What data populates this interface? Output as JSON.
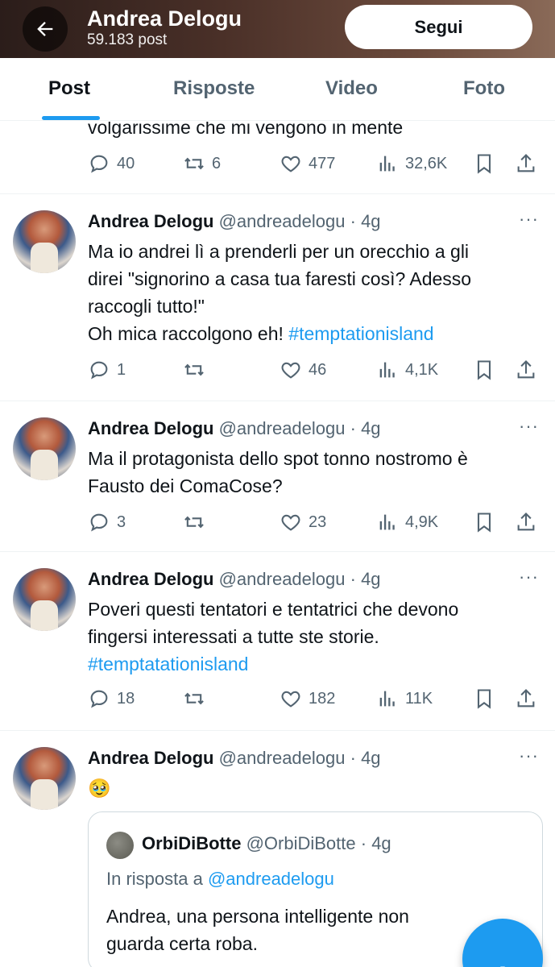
{
  "header": {
    "name": "Andrea Delogu",
    "post_count": "59.183 post",
    "follow_label": "Segui"
  },
  "tabs": [
    {
      "label": "Post",
      "active": true
    },
    {
      "label": "Risposte",
      "active": false
    },
    {
      "label": "Video",
      "active": false
    },
    {
      "label": "Foto",
      "active": false
    }
  ],
  "partial_tweet": {
    "text": "volgarissime che mi vengono in mente",
    "replies": "40",
    "retweets": "6",
    "likes": "477",
    "views": "32,6K"
  },
  "tweets": [
    {
      "name": "Andrea Delogu",
      "handle": "@andreadelogu",
      "time": "· 4g",
      "text": "Ma io andrei lì a prenderli per un orecchio a gli\ndirei \"signorino a casa tua faresti così? Adesso\nraccogli tutto!\"\nOh mica raccolgono eh! ",
      "hashtag": "#temptationisland",
      "replies": "1",
      "retweets": "",
      "likes": "46",
      "views": "4,1K"
    },
    {
      "name": "Andrea Delogu",
      "handle": "@andreadelogu",
      "time": "· 4g",
      "text": "Ma il protagonista dello spot tonno nostromo è\nFausto dei ComaCose?",
      "hashtag": "",
      "replies": "3",
      "retweets": "",
      "likes": "23",
      "views": "4,9K"
    },
    {
      "name": "Andrea Delogu",
      "handle": "@andreadelogu",
      "time": "· 4g",
      "text": "Poveri questi tentatori e tentatrici che devono\nfingersi interessati a tutte ste storie.\n",
      "hashtag": "#temptatationisland",
      "replies": "18",
      "retweets": "",
      "likes": "182",
      "views": "11K"
    },
    {
      "name": "Andrea Delogu",
      "handle": "@andreadelogu",
      "time": "· 4g",
      "text": "🥹",
      "hashtag": ""
    }
  ],
  "quote": {
    "name": "OrbiDiBotte",
    "handle": "@OrbiDiBotte",
    "time": "· 4g",
    "reply_prefix": "In risposta a",
    "reply_mention": "@andreadelogu",
    "text": "Andrea, una persona intelligente non\nguarda certa roba."
  },
  "more_label": "···",
  "fab_label": "+",
  "colors": {
    "accent": "#1d9bf0",
    "text_primary": "#0f1419",
    "text_secondary": "#536471"
  }
}
